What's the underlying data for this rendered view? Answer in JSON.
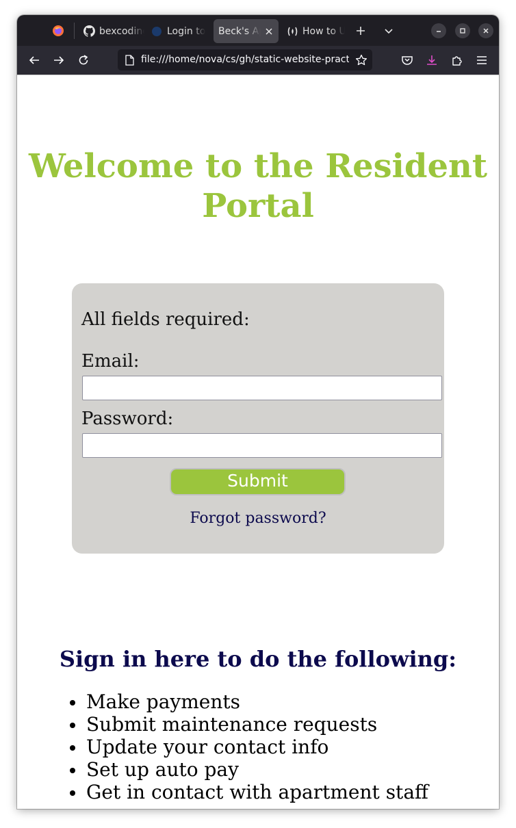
{
  "browser": {
    "tabs": [
      {
        "label": "bexcoding",
        "favicon": "github-icon",
        "active": false
      },
      {
        "label": "Login to",
        "favicon": "globe-icon",
        "active": false
      },
      {
        "label": "Beck's Apartments",
        "favicon": "",
        "active": true
      },
      {
        "label": "How to Use",
        "favicon": "freecodecamp-icon",
        "active": false
      }
    ],
    "url": "file:///home/nova/cs/gh/static-website-practice",
    "accent_colors": {
      "toolbar": "#2b2a33",
      "tabstrip": "#1f1e24",
      "download": "#e04ec9"
    }
  },
  "page": {
    "title": "Welcome to the Resident Portal",
    "title_color": "#9bc53d",
    "form": {
      "required_note": "All fields required:",
      "email_label": "Email:",
      "email_value": "",
      "password_label": "Password:",
      "password_value": "",
      "submit_label": "Submit",
      "forgot_link": "Forgot password?"
    },
    "features": {
      "heading": "Sign in here to do the following:",
      "items": [
        "Make payments",
        "Submit maintenance requests",
        "Update your contact info",
        "Set up auto pay",
        "Get in contact with apartment staff"
      ]
    }
  }
}
